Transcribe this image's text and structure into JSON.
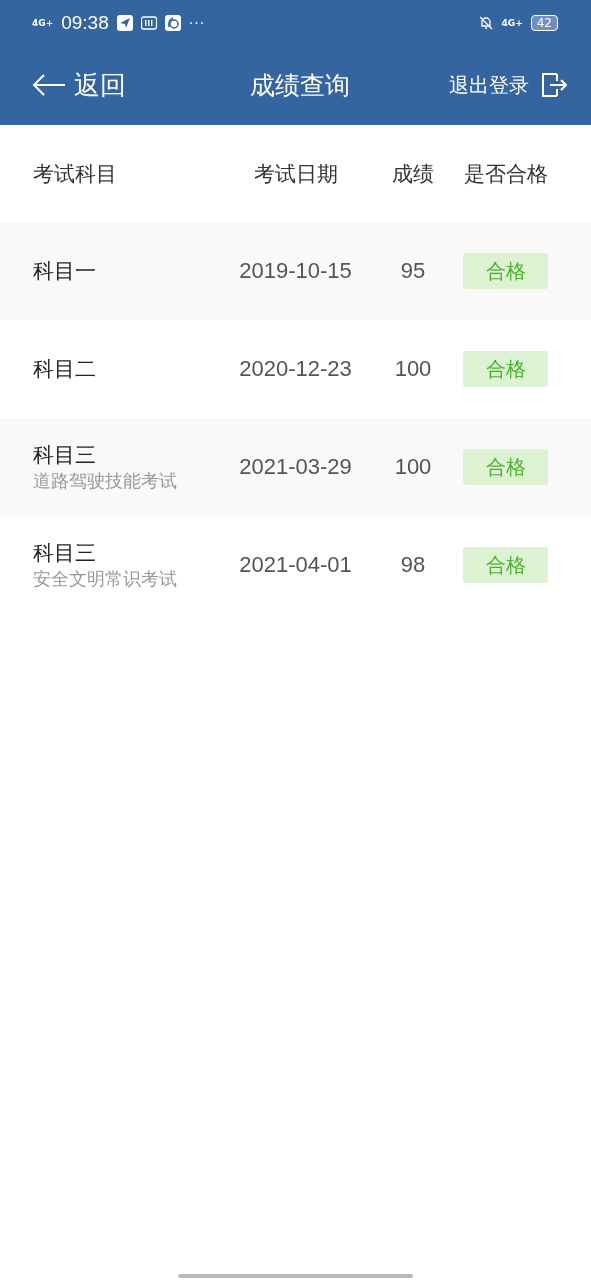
{
  "status_bar": {
    "network_left": "4G+",
    "time": "09:38",
    "more": "···",
    "network_right": "4G+",
    "battery": "42"
  },
  "nav": {
    "back": "返回",
    "title": "成绩查询",
    "logout": "退出登录"
  },
  "table": {
    "columns": [
      "考试科目",
      "考试日期",
      "成绩",
      "是否合格"
    ],
    "rows": [
      {
        "subject": "科目一",
        "date": "2019-10-15",
        "score": "95",
        "result": "合格",
        "passed": true
      },
      {
        "subject": "科目二",
        "date": "2020-12-23",
        "score": "100",
        "result": "合格",
        "passed": true
      },
      {
        "subject": "科目三",
        "detail": "道路驾驶技能考试",
        "date": "2021-03-29",
        "score": "100",
        "result": "合格",
        "passed": true
      },
      {
        "subject": "科目三",
        "detail": "安全文明常识考试",
        "date": "2021-04-01",
        "score": "98",
        "result": "合格",
        "passed": true
      }
    ]
  }
}
